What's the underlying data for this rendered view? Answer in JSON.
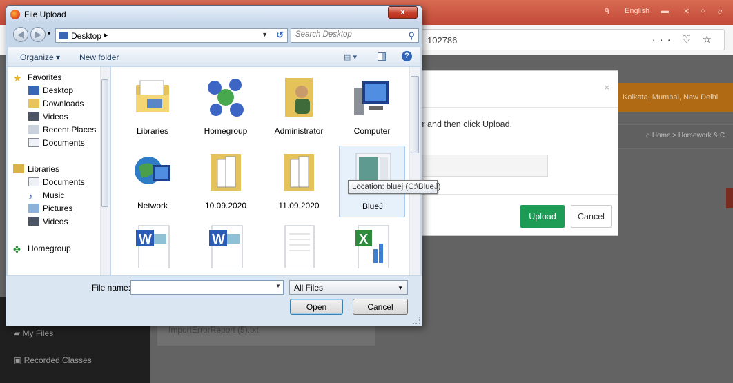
{
  "browser": {
    "lang_label": "English",
    "url_fragment": "102786",
    "url_icons": "··· ♡ ☆",
    "orange_strip_text": "Kolkata, Mumbai, New Delhi",
    "breadcrumb_text": "⌂ Home  >  Homework & C",
    "nav_items": [
      "My Files",
      "Recorded Classes"
    ],
    "file_card_text": "ImportErrorReport (5).txt"
  },
  "upload_modal": {
    "close_label": "×",
    "message": "ter and then click Upload.",
    "upload_label": "Upload",
    "cancel_label": "Cancel",
    "upload_color": "#1e9c56"
  },
  "dialog": {
    "title": "File Upload",
    "close_label": "x",
    "address": "Desktop",
    "address_arrow": "▸",
    "search_placeholder": "Search Desktop",
    "organize_label": "Organize ▾",
    "new_folder_label": "New folder",
    "views_label": "▤ ▾",
    "help_label": "?",
    "nav_pane": {
      "favorites": {
        "label": "Favorites",
        "items": [
          "Desktop",
          "Downloads",
          "Videos",
          "Recent Places",
          "Documents"
        ]
      },
      "libraries": {
        "label": "Libraries",
        "items": [
          "Documents",
          "Music",
          "Pictures",
          "Videos"
        ]
      },
      "homegroup": {
        "label": "Homegroup"
      }
    },
    "files": [
      {
        "name": "Libraries",
        "icon": "libraries-icon"
      },
      {
        "name": "Homegroup",
        "icon": "homegroup-icon"
      },
      {
        "name": "Administrator",
        "icon": "user-folder-icon"
      },
      {
        "name": "Computer",
        "icon": "computer-icon"
      },
      {
        "name": "Network",
        "icon": "network-icon"
      },
      {
        "name": "10.09.2020",
        "icon": "folder-icon"
      },
      {
        "name": "11.09.2020",
        "icon": "folder-icon"
      },
      {
        "name": "BlueJ",
        "icon": "shortcut-icon"
      },
      {
        "name": "",
        "icon": "word-doc-icon"
      },
      {
        "name": "",
        "icon": "word-doc-icon"
      },
      {
        "name": "",
        "icon": "text-file-icon"
      },
      {
        "name": "",
        "icon": "excel-doc-icon"
      }
    ],
    "tooltip": "Location: bluej (C:\\BlueJ)",
    "file_name_label": "File name:",
    "file_name_value": "",
    "file_type": "All Files",
    "open_label": "Open",
    "cancel_label": "Cancel"
  }
}
